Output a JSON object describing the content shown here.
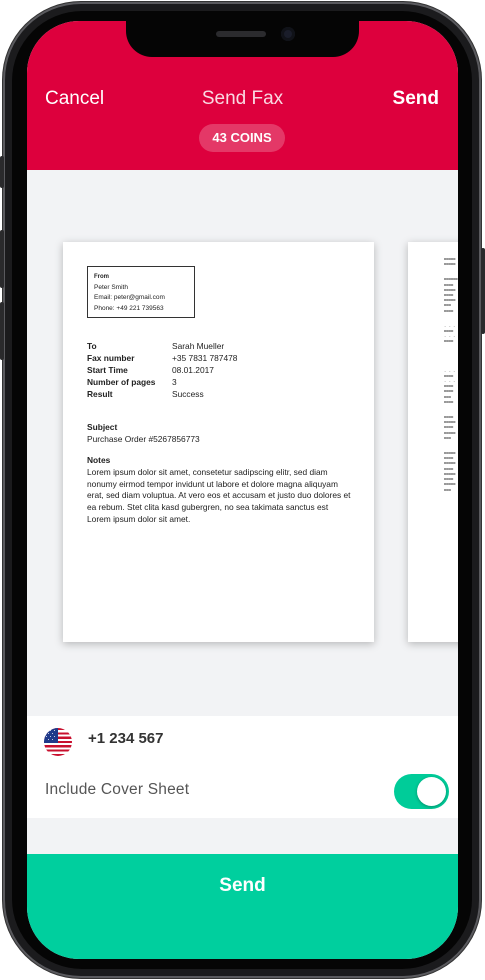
{
  "header": {
    "cancel_label": "Cancel",
    "title": "Send Fax",
    "send_label": "Send",
    "coins_badge": "43 COINS"
  },
  "document": {
    "from": {
      "label": "From",
      "name": "Peter Smith",
      "email": "Email: peter@gmail.com",
      "phone": "Phone: +49 221 739563"
    },
    "fields": [
      {
        "key": "To",
        "value": "Sarah Mueller"
      },
      {
        "key": "Fax number",
        "value": "+35 7831 787478"
      },
      {
        "key": "Start Time",
        "value": "08.01.2017"
      },
      {
        "key": "Number of pages",
        "value": "3"
      },
      {
        "key": "Result",
        "value": "Success"
      }
    ],
    "subject_heading": "Subject",
    "subject_text": "Purchase Order #5267856773",
    "notes_heading": "Notes",
    "notes_text": "Lorem ipsum dolor sit amet, consetetur sadipscing elitr, sed diam nonumy eirmod tempor invidunt ut labore et dolore magna aliquyam erat, sed diam voluptua. At vero eos et accusam et justo duo dolores et ea rebum. Stet clita kasd gubergren, no sea takimata sanctus est Lorem ipsum dolor sit amet."
  },
  "recipient": {
    "flag": "us-flag-icon",
    "number": "+1 234 567"
  },
  "cover_sheet": {
    "label": "Include Cover Sheet",
    "enabled": true
  },
  "footer": {
    "send_label": "Send"
  },
  "colors": {
    "header": "#dd003d",
    "accent": "#00cf9e"
  }
}
